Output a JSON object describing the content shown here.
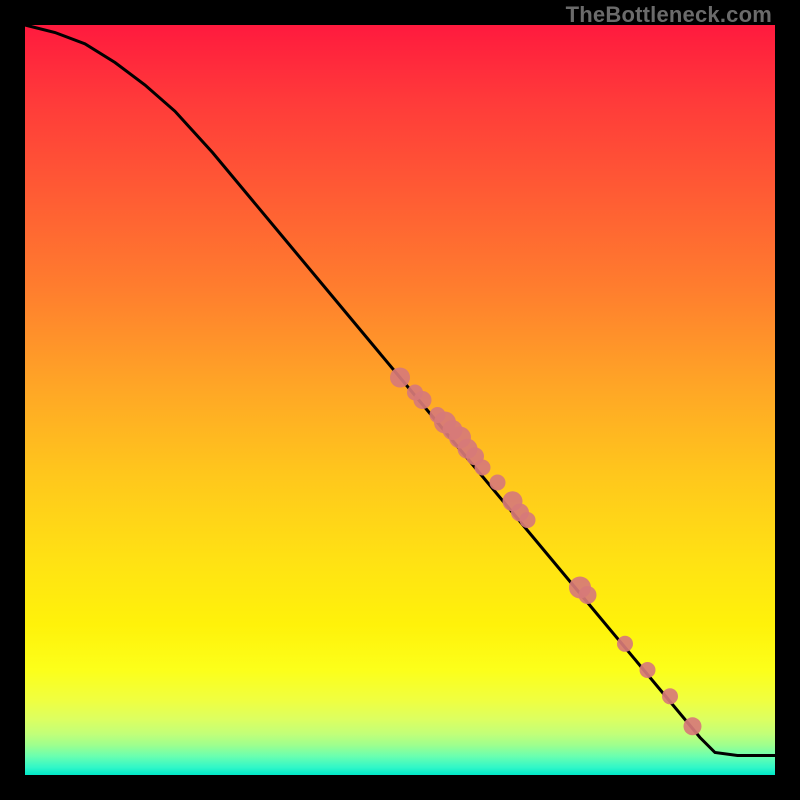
{
  "watermark": "TheBottleneck.com",
  "colors": {
    "point_fill": "#d77a78",
    "line": "#000000"
  },
  "chart_data": {
    "type": "line",
    "title": "",
    "xlabel": "",
    "ylabel": "",
    "xlim": [
      0,
      100
    ],
    "ylim": [
      0,
      100
    ],
    "grid": false,
    "series": [
      {
        "name": "curve",
        "x": [
          0,
          4,
          8,
          12,
          16,
          20,
          25,
          30,
          35,
          40,
          45,
          50,
          55,
          60,
          65,
          70,
          75,
          80,
          85,
          90,
          92,
          95,
          100
        ],
        "y": [
          100,
          99,
          97.5,
          95,
          92,
          88.5,
          83,
          77,
          71,
          65,
          59,
          53,
          47,
          41,
          35,
          29,
          23,
          17,
          11,
          5,
          3,
          2.6,
          2.6
        ]
      }
    ],
    "points": {
      "name": "markers",
      "x": [
        50,
        52,
        53,
        55,
        56,
        57,
        58,
        59,
        60,
        61,
        63,
        65,
        66,
        67,
        74,
        75,
        80,
        83,
        86,
        89
      ],
      "y": [
        53,
        51,
        50,
        48,
        47,
        46,
        45,
        43.5,
        42.5,
        41,
        39,
        36.5,
        35,
        34,
        25,
        24,
        17.5,
        14,
        10.5,
        6.5
      ],
      "r": [
        10,
        8,
        9,
        8,
        11,
        10,
        11,
        10,
        9,
        8,
        8,
        10,
        9,
        8,
        11,
        9,
        8,
        8,
        8,
        9
      ]
    }
  }
}
